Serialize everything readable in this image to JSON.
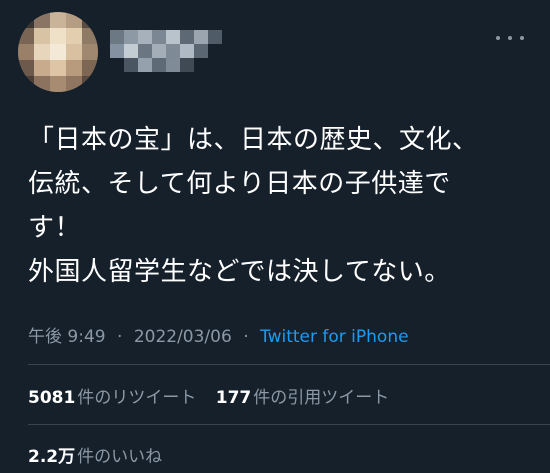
{
  "tweet": {
    "avatar_icon": "user-avatar-pixelated",
    "name_icon": "username-pixelated",
    "more_icon": "more-dots-icon",
    "text": "「日本の宝」は、日本の歴史、文化、\n伝統、そして何より日本の子供達で\nす！\n外国人留学生などでは決してない。",
    "time": "午後 9:49",
    "date": "2022/03/06",
    "separator": "·",
    "source": "Twitter for iPhone"
  },
  "stats": {
    "retweets_count": "5081",
    "retweets_label": "件のリツイート",
    "quotes_count": "177",
    "quotes_label": "件の引用ツイート",
    "likes_count": "2.2万",
    "likes_label": "件のいいね"
  },
  "colors": {
    "background": "#15202b",
    "text": "#ffffff",
    "secondary": "#8b98a5",
    "link": "#1d9bf0",
    "divider": "#38444d"
  }
}
